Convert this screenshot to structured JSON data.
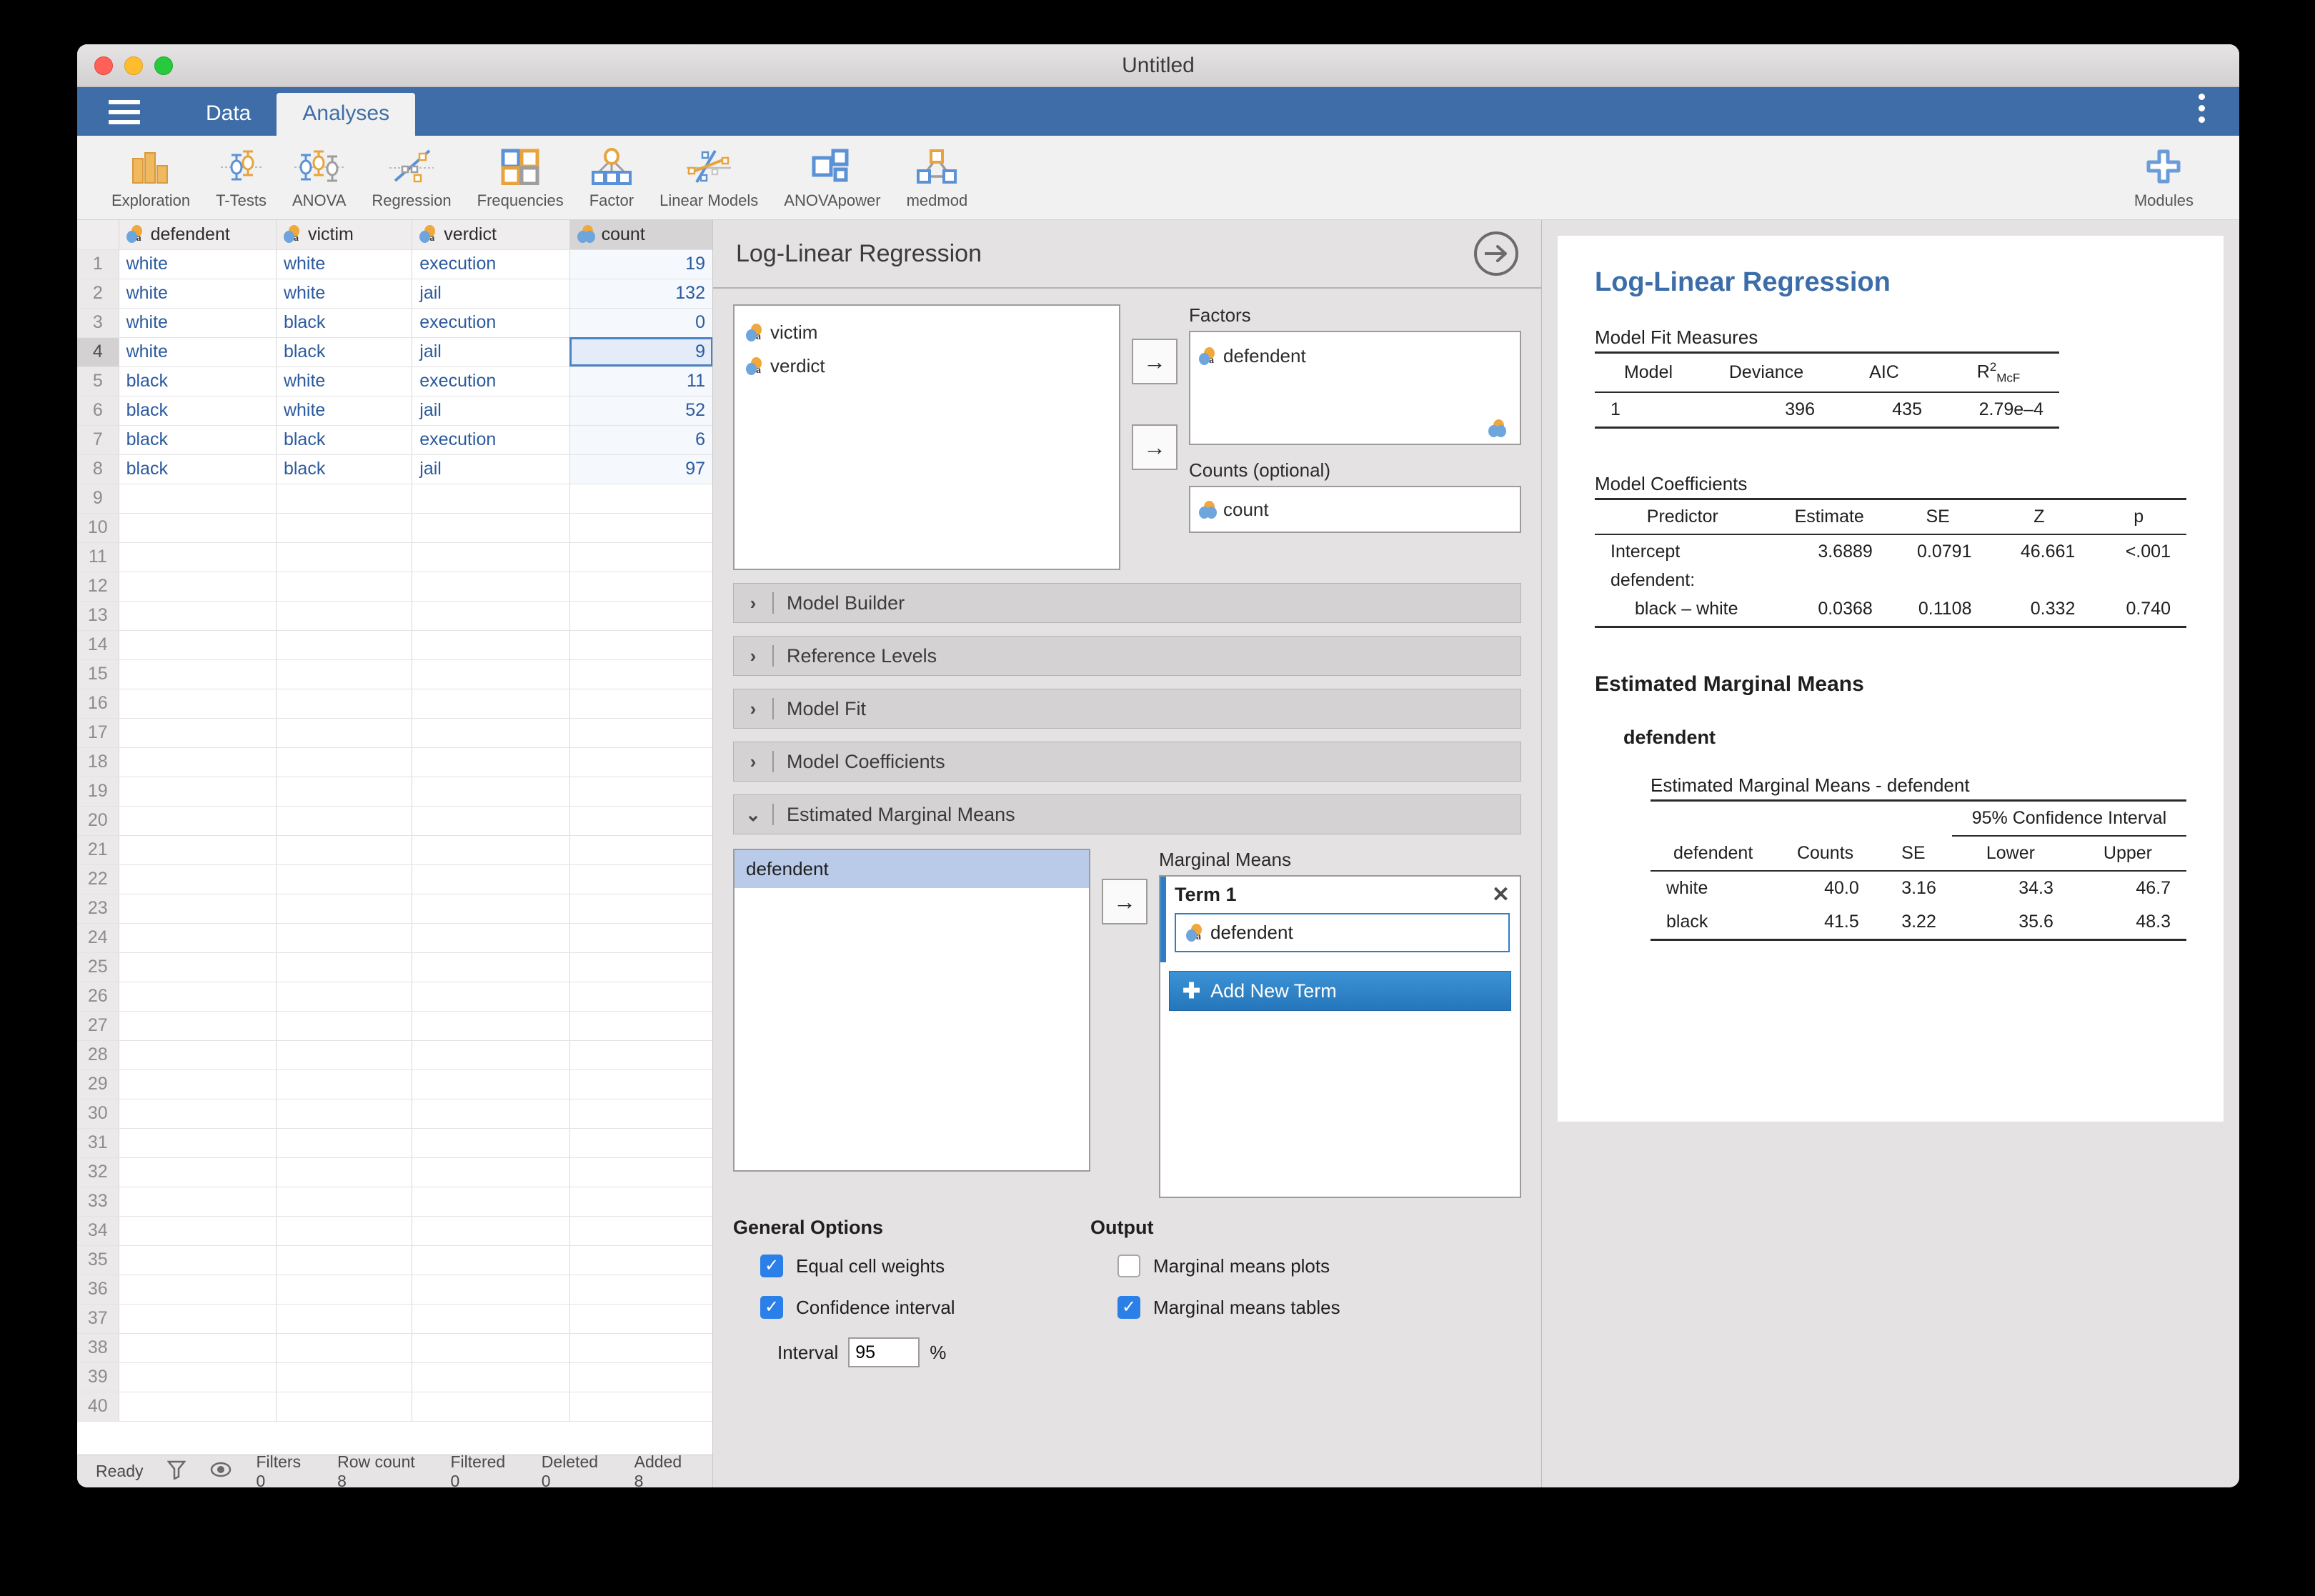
{
  "window": {
    "title": "Untitled"
  },
  "menubar": {
    "hamburger_icon": "hamburger-menu-icon",
    "tabs": [
      {
        "label": "Data",
        "active": false
      },
      {
        "label": "Analyses",
        "active": true
      }
    ],
    "kebab_icon": "vertical-ellipsis-icon"
  },
  "ribbon": {
    "buttons": [
      {
        "label": "Exploration",
        "icon": "bar-chart-icon"
      },
      {
        "label": "T-Tests",
        "icon": "error-bars-two-icon"
      },
      {
        "label": "ANOVA",
        "icon": "error-bars-three-icon"
      },
      {
        "label": "Regression",
        "icon": "scatter-line-icon"
      },
      {
        "label": "Frequencies",
        "icon": "four-squares-icon"
      },
      {
        "label": "Factor",
        "icon": "factor-tree-icon"
      },
      {
        "label": "Linear Models",
        "icon": "linear-models-icon"
      },
      {
        "label": "ANOVApower",
        "icon": "three-squares-icon"
      },
      {
        "label": "medmod",
        "icon": "mediation-triangle-icon"
      }
    ],
    "modules": {
      "label": "Modules",
      "icon": "plus-icon"
    }
  },
  "spreadsheet": {
    "columns": [
      {
        "name": "defendent",
        "icon": "nominal-icon",
        "selected": false
      },
      {
        "name": "victim",
        "icon": "nominal-icon",
        "selected": false
      },
      {
        "name": "verdict",
        "icon": "nominal-icon",
        "selected": false
      },
      {
        "name": "count",
        "icon": "continuous-icon",
        "selected": true
      }
    ],
    "rows": [
      {
        "n": "1",
        "defendent": "white",
        "victim": "white",
        "verdict": "execution",
        "count": "19"
      },
      {
        "n": "2",
        "defendent": "white",
        "victim": "white",
        "verdict": "jail",
        "count": "132"
      },
      {
        "n": "3",
        "defendent": "white",
        "victim": "black",
        "verdict": "execution",
        "count": "0"
      },
      {
        "n": "4",
        "defendent": "white",
        "victim": "black",
        "verdict": "jail",
        "count": "9"
      },
      {
        "n": "5",
        "defendent": "black",
        "victim": "white",
        "verdict": "execution",
        "count": "11"
      },
      {
        "n": "6",
        "defendent": "black",
        "victim": "white",
        "verdict": "jail",
        "count": "52"
      },
      {
        "n": "7",
        "defendent": "black",
        "victim": "black",
        "verdict": "execution",
        "count": "6"
      },
      {
        "n": "8",
        "defendent": "black",
        "victim": "black",
        "verdict": "jail",
        "count": "97"
      }
    ],
    "selected_cell": {
      "row": "4",
      "column": "count",
      "value": "9"
    },
    "empty_row_numbers": [
      "9",
      "10",
      "11",
      "12",
      "13",
      "14",
      "15",
      "16",
      "17",
      "18",
      "19",
      "20",
      "21",
      "22",
      "23",
      "24",
      "25",
      "26",
      "27",
      "28",
      "29",
      "30",
      "31",
      "32",
      "33",
      "34",
      "35",
      "36",
      "37",
      "38",
      "39",
      "40"
    ]
  },
  "statusbar": {
    "ready": "Ready",
    "filter_icon": "funnel-icon",
    "eye_icon": "eye-icon",
    "items": [
      "Filters 0",
      "Row count 8",
      "Filtered 0",
      "Deleted 0",
      "Added 8"
    ]
  },
  "options": {
    "title": "Log-Linear Regression",
    "arrow_icon": "arrow-right-circle-icon",
    "available_variables": [
      {
        "name": "victim",
        "icon": "nominal-icon"
      },
      {
        "name": "verdict",
        "icon": "nominal-icon"
      }
    ],
    "factors": {
      "label": "Factors",
      "items": [
        {
          "name": "defendent",
          "icon": "nominal-icon"
        }
      ]
    },
    "counts": {
      "label": "Counts (optional)",
      "items": [
        {
          "name": "count",
          "icon": "continuous-icon"
        }
      ]
    },
    "sections": [
      {
        "label": "Model Builder",
        "expanded": false
      },
      {
        "label": "Reference Levels",
        "expanded": false
      },
      {
        "label": "Model Fit",
        "expanded": false
      },
      {
        "label": "Model Coefficients",
        "expanded": false
      },
      {
        "label": "Estimated Marginal Means",
        "expanded": true
      }
    ],
    "emm": {
      "left_list": [
        {
          "name": "defendent",
          "selected": true
        }
      ],
      "marginal_means_label": "Marginal Means",
      "term": {
        "title": "Term 1",
        "close_icon": "close-icon",
        "items": [
          {
            "name": "defendent",
            "icon": "nominal-icon"
          }
        ]
      },
      "add_new_term": "Add New Term"
    },
    "general_options": {
      "heading": "General Options",
      "checkboxes": [
        {
          "label": "Equal cell weights",
          "checked": true
        },
        {
          "label": "Confidence interval",
          "checked": true
        }
      ],
      "interval_label": "Interval",
      "interval_value": "95",
      "interval_unit": "%"
    },
    "output": {
      "heading": "Output",
      "checkboxes": [
        {
          "label": "Marginal means plots",
          "checked": false
        },
        {
          "label": "Marginal means tables",
          "checked": true
        }
      ]
    }
  },
  "results": {
    "title": "Log-Linear Regression",
    "model_fit": {
      "caption": "Model Fit Measures",
      "headers": [
        "Model",
        "Deviance",
        "AIC",
        "R²McF"
      ],
      "rows": [
        {
          "model": "1",
          "deviance": "396",
          "aic": "435",
          "r2": "2.79e–4"
        }
      ]
    },
    "model_coefficients": {
      "caption": "Model Coefficients",
      "headers": [
        "Predictor",
        "Estimate",
        "SE",
        "Z",
        "p"
      ],
      "rows": [
        {
          "predictor": "Intercept",
          "estimate": "3.6889",
          "se": "0.0791",
          "z": "46.661",
          "p": "<.001",
          "indent": false
        },
        {
          "predictor": "defendent:",
          "estimate": "",
          "se": "",
          "z": "",
          "p": "",
          "indent": false
        },
        {
          "predictor": "black – white",
          "estimate": "0.0368",
          "se": "0.1108",
          "z": "0.332",
          "p": "0.740",
          "indent": true
        }
      ]
    },
    "emm_section": {
      "heading": "Estimated Marginal Means",
      "subheading": "defendent",
      "caption": "Estimated Marginal Means - defendent",
      "ci_header": "95% Confidence Interval",
      "headers": [
        "defendent",
        "Counts",
        "SE",
        "Lower",
        "Upper"
      ],
      "rows": [
        {
          "defendent": "white",
          "counts": "40.0",
          "se": "3.16",
          "lower": "34.3",
          "upper": "46.7"
        },
        {
          "defendent": "black",
          "counts": "41.5",
          "se": "3.22",
          "lower": "35.6",
          "upper": "48.3"
        }
      ]
    }
  }
}
